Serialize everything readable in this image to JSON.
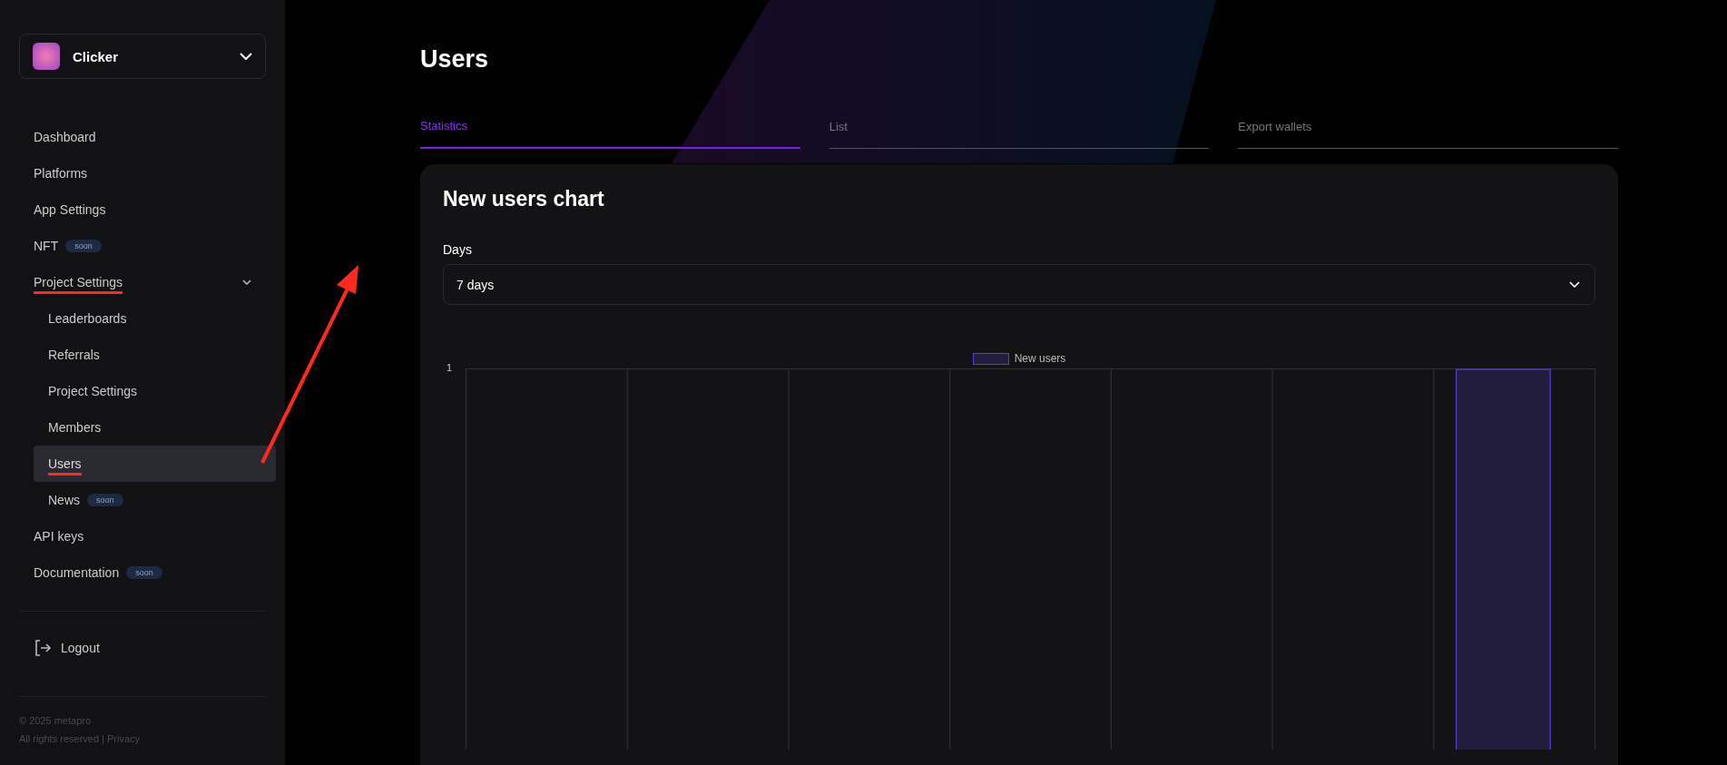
{
  "sidebar": {
    "workspace": {
      "name": "Clicker"
    },
    "items": [
      {
        "label": "Dashboard",
        "selected": false,
        "annotated": false
      },
      {
        "label": "Platforms",
        "selected": false,
        "annotated": false
      },
      {
        "label": "App Settings",
        "selected": false,
        "annotated": false
      },
      {
        "label": "NFT",
        "badge": "soon",
        "selected": false,
        "annotated": false
      },
      {
        "label": "Project Settings",
        "selected": false,
        "expanded": true,
        "annotated": true,
        "children": [
          {
            "label": "Leaderboards",
            "selected": false,
            "annotated": false
          },
          {
            "label": "Referrals",
            "selected": false,
            "annotated": false
          },
          {
            "label": "Project Settings",
            "selected": false,
            "annotated": false
          },
          {
            "label": "Members",
            "selected": false,
            "annotated": false
          },
          {
            "label": "Users",
            "selected": true,
            "annotated": true
          },
          {
            "label": "News",
            "badge": "soon",
            "selected": false,
            "annotated": false
          }
        ]
      },
      {
        "label": "API keys",
        "selected": false,
        "annotated": false
      },
      {
        "label": "Documentation",
        "badge": "soon",
        "selected": false,
        "annotated": false
      }
    ],
    "logout": "Logout",
    "footer": {
      "copyright": "© 2025 metapro",
      "rights": "All rights reserved | Privacy"
    }
  },
  "page": {
    "title": "Users"
  },
  "tabs": [
    {
      "label": "Statistics",
      "selected": true
    },
    {
      "label": "List",
      "selected": false
    },
    {
      "label": "Export wallets",
      "selected": false
    }
  ],
  "card": {
    "title": "New users chart",
    "days": {
      "label": "Days",
      "value": "7 days"
    },
    "chart": {
      "legend": "New users",
      "y_tick": "1"
    }
  }
}
